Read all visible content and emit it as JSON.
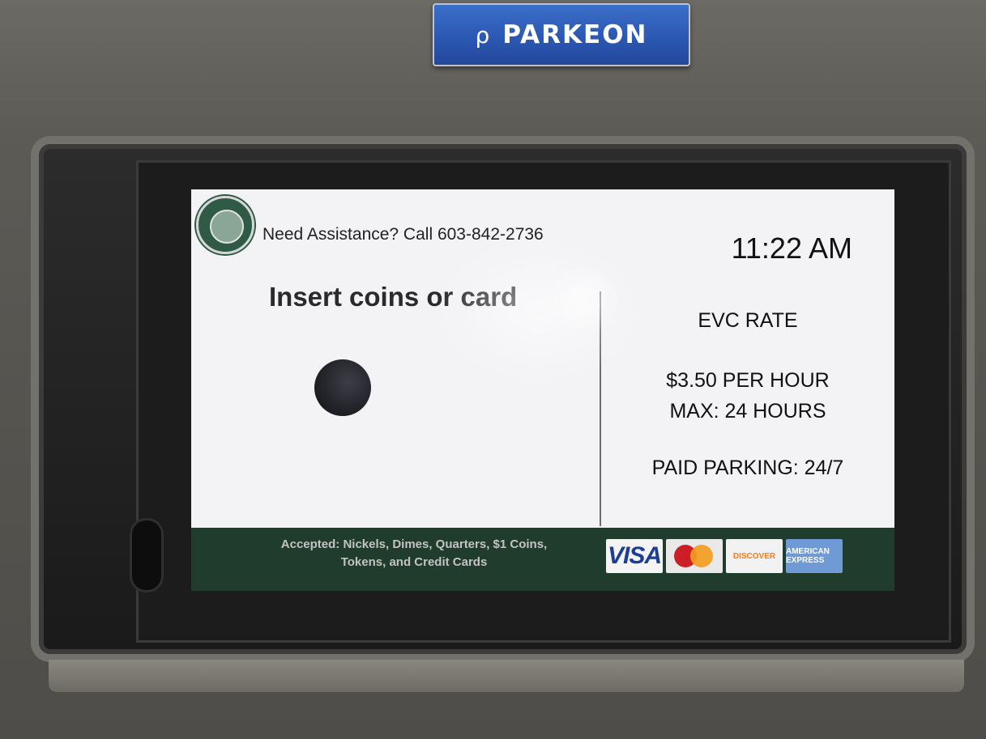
{
  "brand": {
    "name": "PARKEON",
    "mark": "ρ",
    "color": "#2b58b3"
  },
  "screen": {
    "seal_icon": "city-seal-icon",
    "assistance_text": "Need Assistance? Call 603-842-2736",
    "time": "11:22 AM",
    "prompt": "Insert coins or card",
    "coin_icon": "coin-slot-icon",
    "rate": {
      "title": "EVC RATE",
      "price": "$3.50 PER HOUR",
      "max": "MAX: 24 HOURS",
      "hours": "PAID PARKING: 24/7"
    },
    "footer": {
      "accepted_line1": "Accepted: Nickels, Dimes, Quarters, $1 Coins,",
      "accepted_line2": "Tokens, and Credit Cards",
      "cards": [
        {
          "label": "VISA",
          "icon": "visa-card-icon"
        },
        {
          "label": "",
          "icon": "mastercard-card-icon"
        },
        {
          "label": "DISCOVER",
          "icon": "discover-card-icon"
        },
        {
          "label": "AMERICAN EXPRESS",
          "icon": "amex-card-icon"
        }
      ],
      "color": "#203c2c"
    }
  }
}
